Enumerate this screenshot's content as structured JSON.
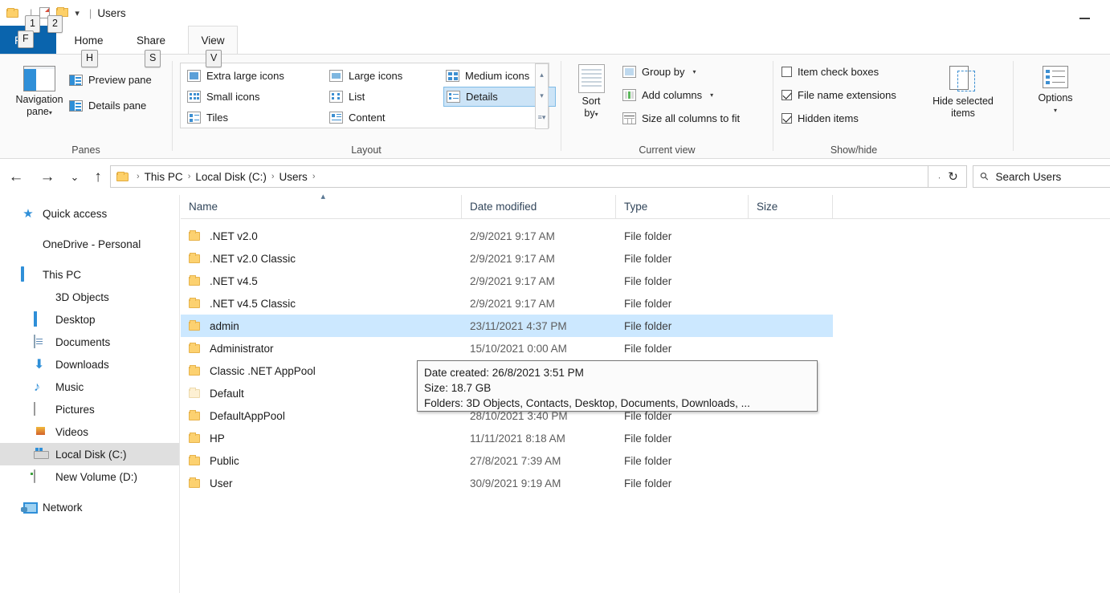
{
  "window": {
    "title": "Users",
    "minimize_label": "Minimize",
    "quick_access": {
      "folder_icon": "folder-icon",
      "properties_icon": "properties-icon",
      "new_folder_icon": "new-folder-icon",
      "customize_caret": "▾"
    }
  },
  "keytips": {
    "file": "F",
    "qat_1": "1",
    "qat_2": "2",
    "home": "H",
    "share": "S",
    "view": "V"
  },
  "tabs": [
    {
      "label": "File",
      "id": "file",
      "active": false
    },
    {
      "label": "Home",
      "id": "home",
      "active": false
    },
    {
      "label": "Share",
      "id": "share",
      "active": false
    },
    {
      "label": "View",
      "id": "view",
      "active": true
    }
  ],
  "ribbon": {
    "groups": [
      {
        "id": "panes",
        "label": "Panes"
      },
      {
        "id": "layout",
        "label": "Layout"
      },
      {
        "id": "current_view",
        "label": "Current view"
      },
      {
        "id": "show_hide",
        "label": "Show/hide"
      }
    ],
    "panes": {
      "navigation_pane": "Navigation\npane",
      "navigation_pane_line1": "Navigation",
      "navigation_pane_line2": "pane",
      "navigation_caret": "▾",
      "preview_pane": "Preview pane",
      "details_pane": "Details pane"
    },
    "layout": {
      "items": [
        {
          "label": "Extra large icons",
          "selected": false
        },
        {
          "label": "Large icons",
          "selected": false
        },
        {
          "label": "Medium icons",
          "selected": false
        },
        {
          "label": "Small icons",
          "selected": false
        },
        {
          "label": "List",
          "selected": false
        },
        {
          "label": "Details",
          "selected": true
        },
        {
          "label": "Tiles",
          "selected": false
        },
        {
          "label": "Content",
          "selected": false
        }
      ],
      "scroll_up": "▴",
      "scroll_down": "▾",
      "scroll_more": "▾"
    },
    "current_view": {
      "sort_by_line1": "Sort",
      "sort_by_line2": "by",
      "sort_by_caret": "▾",
      "group_by": "Group by",
      "group_by_caret": "▾",
      "add_columns": "Add columns",
      "add_columns_caret": "▾",
      "size_all_columns": "Size all columns to fit"
    },
    "show_hide": {
      "item_check_boxes": {
        "label": "Item check boxes",
        "checked": false
      },
      "file_name_extensions": {
        "label": "File name extensions",
        "checked": true
      },
      "hidden_items": {
        "label": "Hidden items",
        "checked": true
      },
      "hide_selected_line1": "Hide selected",
      "hide_selected_line2": "items",
      "options_label": "Options",
      "options_caret": "▾"
    }
  },
  "address_bar": {
    "back": "←",
    "forward": "→",
    "recent": "⌄",
    "up": "↑",
    "breadcrumbs": [
      "This PC",
      "Local Disk (C:)",
      "Users"
    ],
    "separator": "›",
    "dropdown_caret": "⌄",
    "refresh": "↻",
    "search_placeholder": "Search Users"
  },
  "sidebar": {
    "items": [
      {
        "label": "Quick access",
        "icon": "star-icon",
        "indent": false,
        "selected": false,
        "gap_after": true
      },
      {
        "label": "OneDrive - Personal",
        "icon": "cloud-icon",
        "indent": false,
        "selected": false,
        "gap_after": true
      },
      {
        "label": "This PC",
        "icon": "computer-icon",
        "indent": false,
        "selected": false,
        "gap_after": false
      },
      {
        "label": "3D Objects",
        "icon": "cube-icon",
        "indent": true,
        "selected": false,
        "gap_after": false
      },
      {
        "label": "Desktop",
        "icon": "desktop-icon",
        "indent": true,
        "selected": false,
        "gap_after": false
      },
      {
        "label": "Documents",
        "icon": "document-icon",
        "indent": true,
        "selected": false,
        "gap_after": false
      },
      {
        "label": "Downloads",
        "icon": "download-icon",
        "indent": true,
        "selected": false,
        "gap_after": false
      },
      {
        "label": "Music",
        "icon": "music-icon",
        "indent": true,
        "selected": false,
        "gap_after": false
      },
      {
        "label": "Pictures",
        "icon": "picture-icon",
        "indent": true,
        "selected": false,
        "gap_after": false
      },
      {
        "label": "Videos",
        "icon": "video-icon",
        "indent": true,
        "selected": false,
        "gap_after": false
      },
      {
        "label": "Local Disk (C:)",
        "icon": "hard-disk-icon",
        "indent": true,
        "selected": true,
        "gap_after": false
      },
      {
        "label": "New Volume (D:)",
        "icon": "drive-icon",
        "indent": true,
        "selected": false,
        "gap_after": true
      },
      {
        "label": "Network",
        "icon": "network-icon",
        "indent": false,
        "selected": false,
        "gap_after": false
      }
    ]
  },
  "file_list": {
    "columns": [
      {
        "label": "Name",
        "sorted": true
      },
      {
        "label": "Date modified",
        "sorted": false
      },
      {
        "label": "Type",
        "sorted": false
      },
      {
        "label": "Size",
        "sorted": false
      }
    ],
    "rows": [
      {
        "name": ".NET v2.0",
        "date": "2/9/2021 9:17 AM",
        "type": "File folder",
        "size": "",
        "selected": false,
        "ghost": false
      },
      {
        "name": ".NET v2.0 Classic",
        "date": "2/9/2021 9:17 AM",
        "type": "File folder",
        "size": "",
        "selected": false,
        "ghost": false
      },
      {
        "name": ".NET v4.5",
        "date": "2/9/2021 9:17 AM",
        "type": "File folder",
        "size": "",
        "selected": false,
        "ghost": false
      },
      {
        "name": ".NET v4.5 Classic",
        "date": "2/9/2021 9:17 AM",
        "type": "File folder",
        "size": "",
        "selected": false,
        "ghost": false
      },
      {
        "name": "admin",
        "date": "23/11/2021 4:37 PM",
        "type": "File folder",
        "size": "",
        "selected": true,
        "ghost": false
      },
      {
        "name": "Administrator",
        "date": "15/10/2021 0:00 AM",
        "type": "File folder",
        "size": "",
        "selected": false,
        "ghost": false
      },
      {
        "name": "Classic .NET AppPool",
        "date": "",
        "type": "",
        "size": "",
        "selected": false,
        "ghost": false
      },
      {
        "name": "Default",
        "date": "",
        "type": "",
        "size": "",
        "selected": false,
        "ghost": true
      },
      {
        "name": "DefaultAppPool",
        "date": "28/10/2021 3:40 PM",
        "type": "File folder",
        "size": "",
        "selected": false,
        "ghost": false
      },
      {
        "name": "HP",
        "date": "11/11/2021 8:18 AM",
        "type": "File folder",
        "size": "",
        "selected": false,
        "ghost": false
      },
      {
        "name": "Public",
        "date": "27/8/2021 7:39 AM",
        "type": "File folder",
        "size": "",
        "selected": false,
        "ghost": false
      },
      {
        "name": "User",
        "date": "30/9/2021 9:19 AM",
        "type": "File folder",
        "size": "",
        "selected": false,
        "ghost": false
      }
    ]
  },
  "tooltip": {
    "line1": "Date created: 26/8/2021 3:51 PM",
    "line2": "Size: 18.7 GB",
    "line3": "Folders: 3D Objects, Contacts, Desktop, Documents, Downloads, ..."
  },
  "colors": {
    "file_tab": "#0a64ad",
    "selection": "#cce8ff",
    "ribbon_bg": "#fafafa",
    "sidebar_selection": "#dfdfdf",
    "folder_yellow": "#fcd170"
  }
}
